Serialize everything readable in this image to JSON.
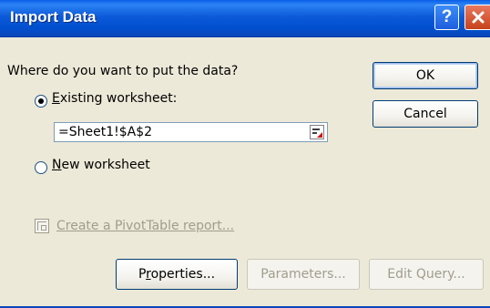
{
  "window": {
    "title": "Import Data"
  },
  "question": "Where do you want to put the data?",
  "options": {
    "existing_label": "Existing worksheet:",
    "existing_selected": true,
    "reference_value": "=Sheet1!$A$2",
    "new_label": "New worksheet",
    "new_selected": false
  },
  "pivot_link": "Create a PivotTable report...",
  "buttons": {
    "ok": "OK",
    "cancel": "Cancel",
    "properties": "Properties...",
    "parameters": "Parameters...",
    "edit_query": "Edit Query..."
  },
  "icons": {
    "help": "help-icon",
    "close": "close-icon",
    "collapse": "collapse-dialog-icon",
    "pivot": "pivot-table-icon"
  },
  "colors": {
    "titlebar": "#0A5FE6",
    "dialog_bg": "#ECE9D8",
    "close": "#E0603F",
    "disabled_text": "#A19D8E"
  }
}
